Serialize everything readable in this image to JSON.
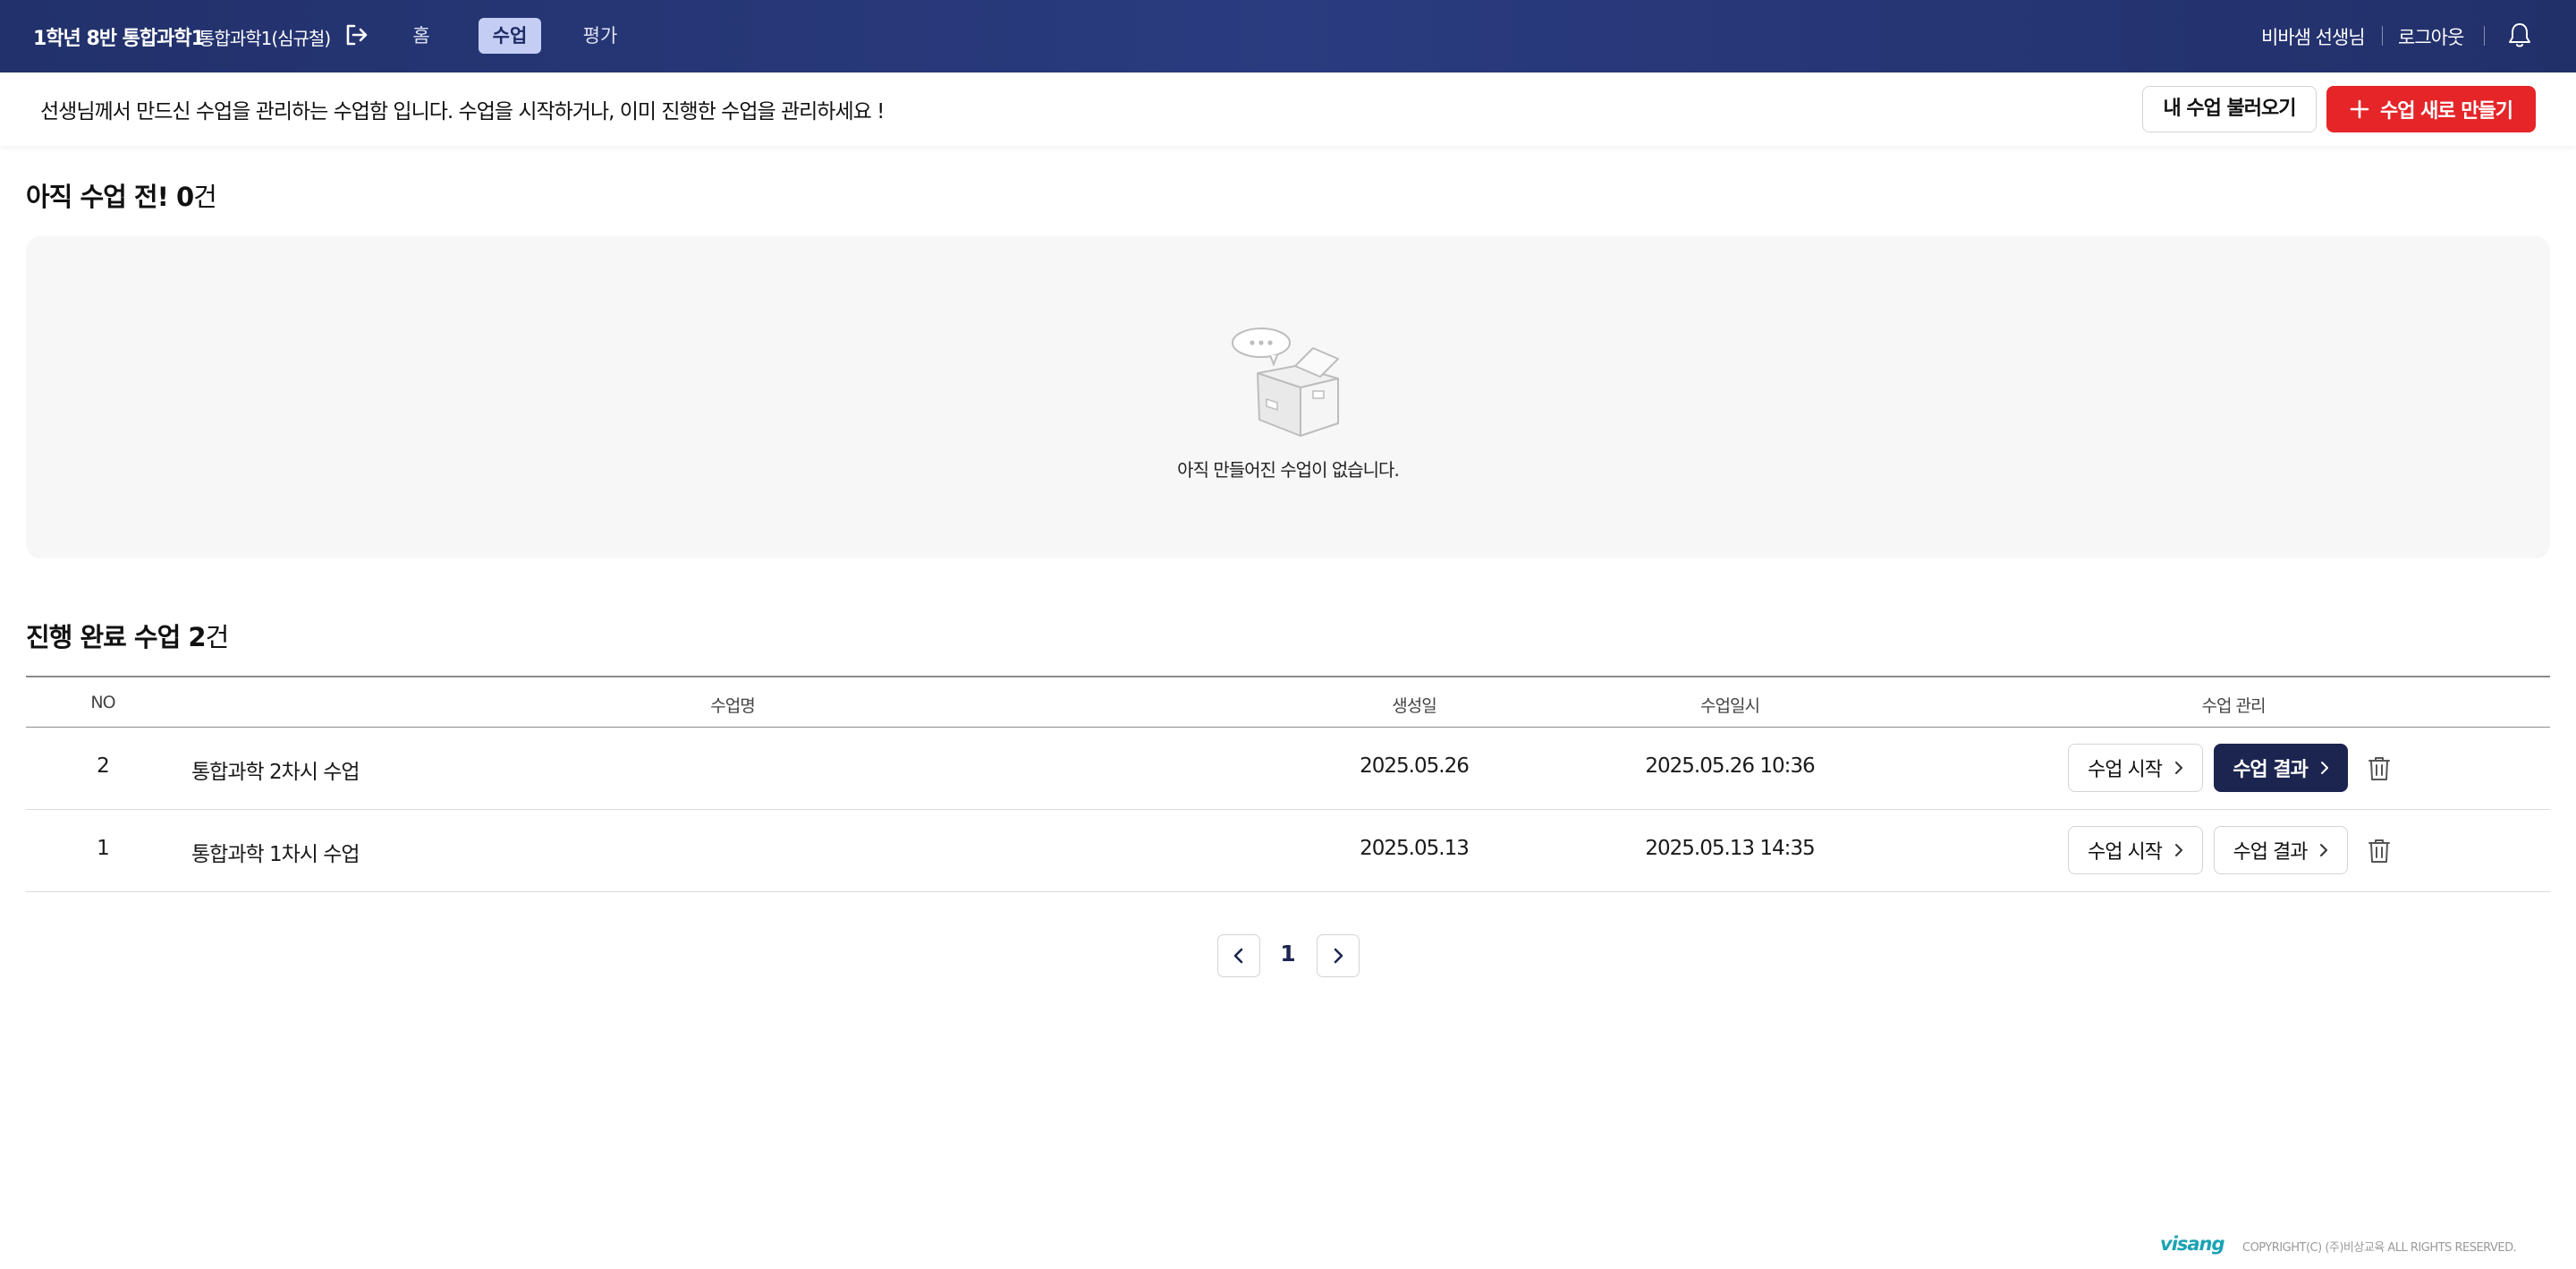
{
  "header": {
    "class_name": "1학년 8반 통합과학1",
    "subject": "통합과학1(심규철)",
    "nav": [
      {
        "label": "홈"
      },
      {
        "label": "수업"
      },
      {
        "label": "평가"
      }
    ],
    "active_nav": "수업",
    "teacher": "비바샘 선생님",
    "logout": "로그아웃"
  },
  "infobar": {
    "message": "선생님께서 만드신 수업을 관리하는 수업함 입니다. 수업을 시작하거나, 이미 진행한 수업을 관리하세요 !",
    "load_button": "내 수업 불러오기",
    "new_button": "수업 새로 만들기"
  },
  "pending": {
    "title_prefix": "아직 수업 전!",
    "count": "0",
    "unit": "건",
    "empty_message": "아직 만들어진 수업이 없습니다."
  },
  "completed": {
    "title_prefix": "진행 완료 수업",
    "count": "2",
    "unit": "건",
    "columns": [
      "NO",
      "수업명",
      "생성일",
      "수업일시",
      "수업 관리"
    ],
    "rows": [
      {
        "no": "2",
        "name": "통합과학 2차시 수업",
        "created": "2025.05.26",
        "datetime": "2025.05.26 10:36",
        "start_label": "수업 시작",
        "result_label": "수업 결과"
      },
      {
        "no": "1",
        "name": "통합과학 1차시 수업",
        "created": "2025.05.13",
        "datetime": "2025.05.13 14:35",
        "start_label": "수업 시작",
        "result_label": "수업 결과"
      }
    ]
  },
  "pagination": {
    "current": "1"
  },
  "footer": {
    "logo": "visang",
    "copyright": "COPYRIGHT(C) (주)비상교육 ALL RIGHTS RESERVED."
  },
  "colors": {
    "header_bg": "#26357a",
    "active_nav_bg": "#c4cef5",
    "accent_red": "#e52528",
    "primary_dark": "#1c2550",
    "logo_teal": "#1aa3b4"
  },
  "icons": [
    "exit-icon",
    "bell-icon",
    "plus-icon",
    "empty-box-icon",
    "chevron-right-icon",
    "trash-icon",
    "chevron-left-icon"
  ]
}
